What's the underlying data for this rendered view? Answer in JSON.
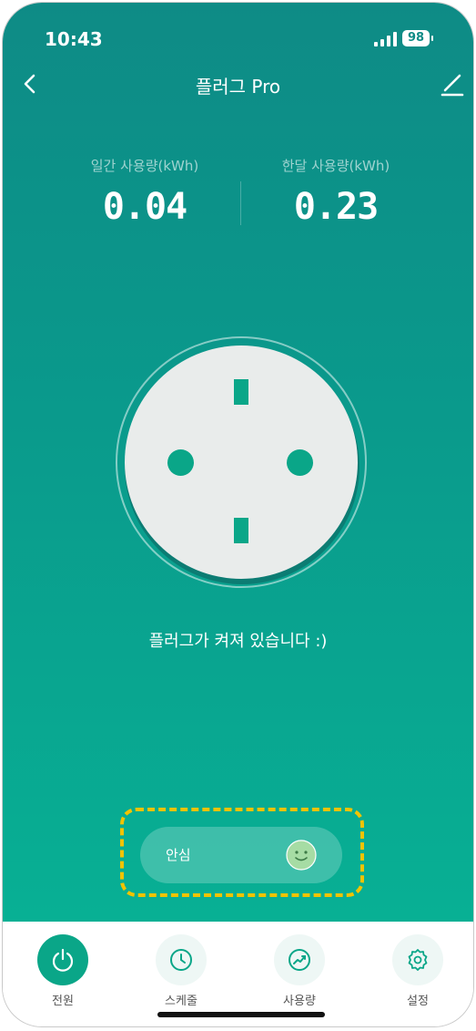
{
  "status_bar": {
    "time": "10:43",
    "battery": "98"
  },
  "header": {
    "title": "플러그 Pro"
  },
  "stats": {
    "daily": {
      "label": "일간 사용량(kWh)",
      "value": "0.04"
    },
    "monthly": {
      "label": "한달 사용량(kWh)",
      "value": "0.23"
    }
  },
  "plug": {
    "status_message": "플러그가 켜져 있습니다 :)"
  },
  "safe_mode": {
    "label": "안심"
  },
  "tabs": [
    {
      "label": "전원",
      "icon": "power-icon",
      "active": true
    },
    {
      "label": "스케줄",
      "icon": "clock-icon",
      "active": false
    },
    {
      "label": "사용량",
      "icon": "trend-icon",
      "active": false
    },
    {
      "label": "설정",
      "icon": "gear-icon",
      "active": false
    }
  ],
  "colors": {
    "accent": "#0aa688",
    "highlight": "#f2c300"
  }
}
